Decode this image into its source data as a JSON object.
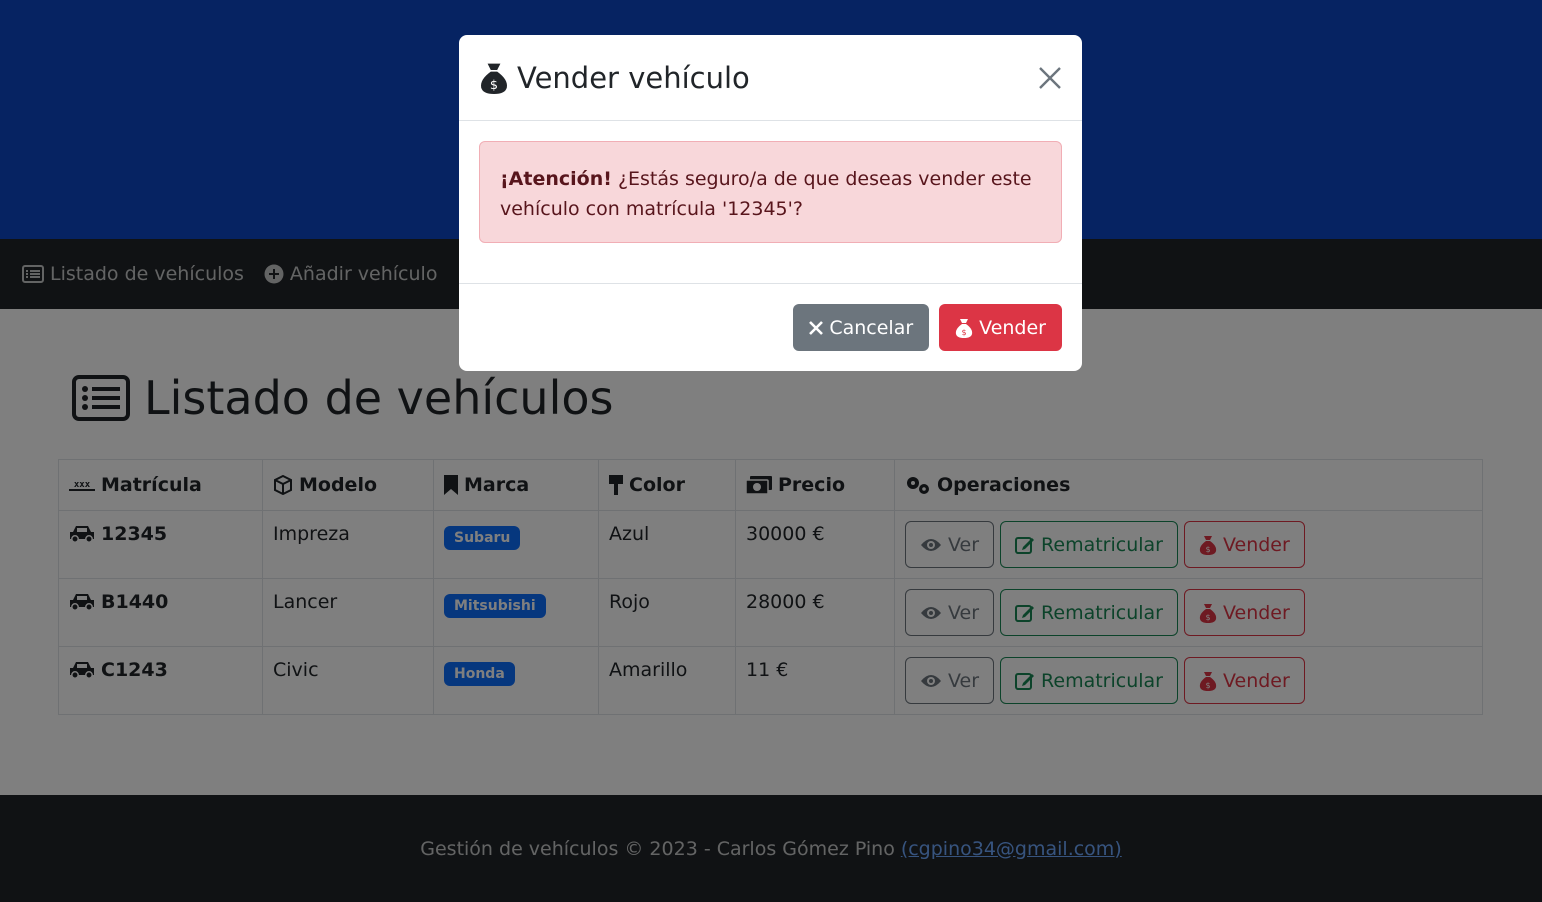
{
  "navbar": {
    "items": [
      {
        "label": "Listado de vehículos",
        "icon": "list-icon"
      },
      {
        "label": "Añadir vehículo",
        "icon": "plus-circle-icon"
      }
    ]
  },
  "main": {
    "title": "Listado de vehículos",
    "table": {
      "headers": {
        "plate": "Matrícula",
        "model": "Modelo",
        "brand": "Marca",
        "color": "Color",
        "price": "Precio",
        "operations": "Operaciones"
      },
      "rows": [
        {
          "plate": "12345",
          "model": "Impreza",
          "brand": "Subaru",
          "color": "Azul",
          "price": "30000 €"
        },
        {
          "plate": "B1440",
          "model": "Lancer",
          "brand": "Mitsubishi",
          "color": "Rojo",
          "price": "28000 €"
        },
        {
          "plate": "C1243",
          "model": "Civic",
          "brand": "Honda",
          "color": "Amarillo",
          "price": "11 €"
        }
      ],
      "buttons": {
        "view": "Ver",
        "reregister": "Rematricular",
        "sell": "Vender"
      }
    }
  },
  "footer": {
    "text": "Gestión de vehículos © 2023 - Carlos Gómez Pino",
    "email": "(cgpino34@gmail.com)"
  },
  "modal": {
    "title": "Vender vehículo",
    "alert_strong": "¡Atención!",
    "alert_text": "¿Estás seguro/a de que deseas vender este vehículo con matrícula '12345'?",
    "cancel_label": "Cancelar",
    "confirm_label": "Vender"
  },
  "colors": {
    "header": "#0d47c5",
    "navbar": "#212529",
    "primary": "#0d6efd",
    "danger": "#dc3545",
    "success": "#198754",
    "secondary": "#6c757d"
  }
}
